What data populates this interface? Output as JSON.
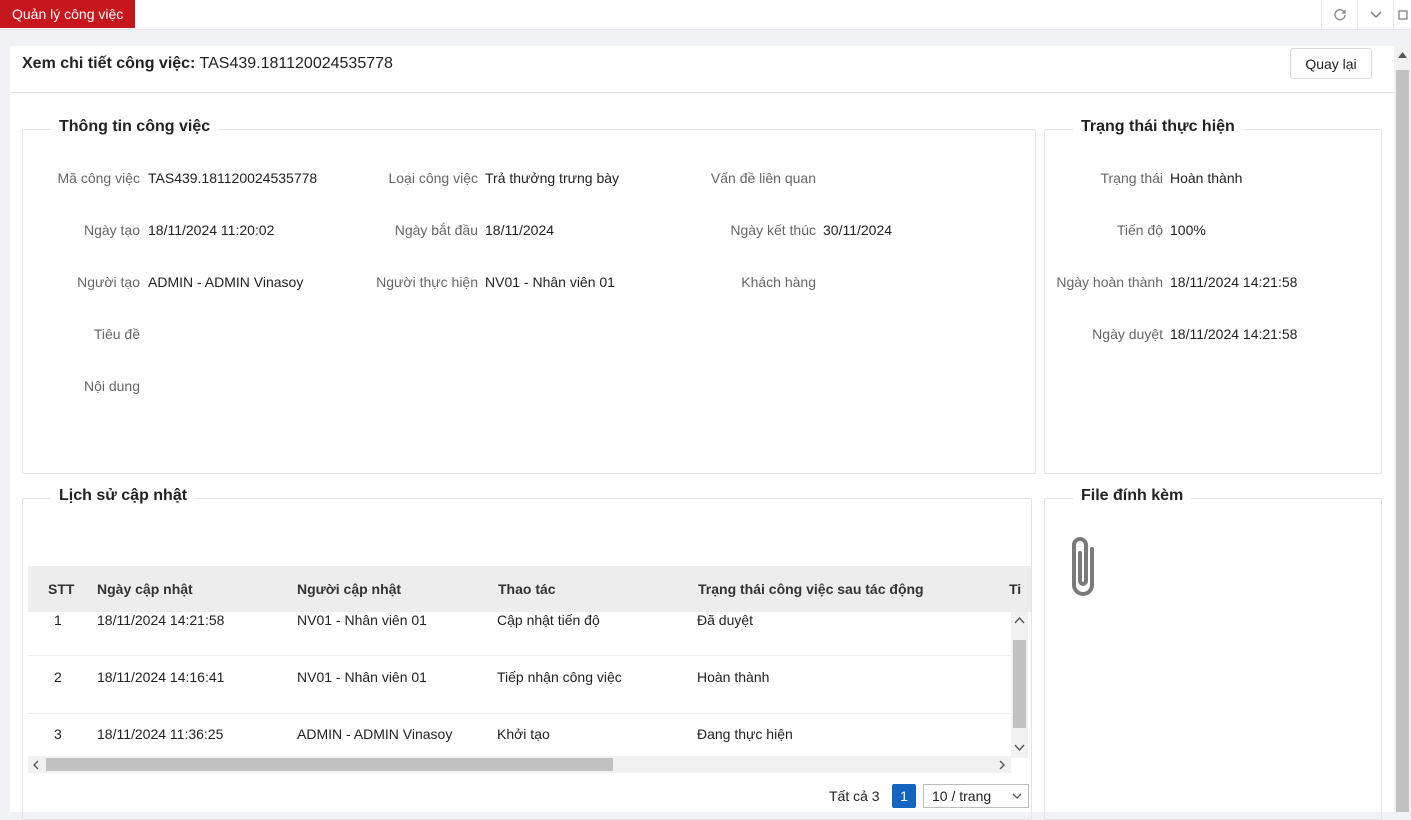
{
  "topbar": {
    "active_tab": "Quản lý công việc"
  },
  "header": {
    "title_label": "Xem chi tiết công việc:",
    "title_code": "TAS439.181120024535778",
    "back_button": "Quay lại"
  },
  "task_info": {
    "legend": "Thông tin công việc",
    "fields": [
      {
        "label": "Mã công việc",
        "value": "TAS439.181120024535778"
      },
      {
        "label": "Loại công việc",
        "value": "Trả thưởng trưng bày"
      },
      {
        "label": "Vấn đề liên quan",
        "value": ""
      },
      {
        "label": "Ngày tạo",
        "value": "18/11/2024 11:20:02"
      },
      {
        "label": "Ngày bắt đầu",
        "value": "18/11/2024"
      },
      {
        "label": "Ngày kết thúc",
        "value": "30/11/2024"
      },
      {
        "label": "Người tạo",
        "value": "ADMIN - ADMIN Vinasoy"
      },
      {
        "label": "Người thực hiện",
        "value": "NV01 - Nhân viên 01"
      },
      {
        "label": "Khách hàng",
        "value": ""
      },
      {
        "label": "Tiêu đề",
        "value": ""
      },
      {
        "label": "Nội dung",
        "value": ""
      }
    ]
  },
  "status": {
    "legend": "Trạng thái thực hiện",
    "fields": [
      {
        "label": "Trạng thái",
        "value": "Hoàn thành"
      },
      {
        "label": "Tiến độ",
        "value": "100%"
      },
      {
        "label": "Ngày hoàn thành",
        "value": "18/11/2024 14:21:58"
      },
      {
        "label": "Ngày duyệt",
        "value": "18/11/2024 14:21:58"
      }
    ]
  },
  "history": {
    "legend": "Lịch sử cập nhật",
    "columns": [
      "STT",
      "Ngày cập nhật",
      "Người cập nhật",
      "Thao tác",
      "Trạng thái công việc sau tác động",
      "Ti"
    ],
    "rows": [
      [
        "1",
        "18/11/2024 14:21:58",
        "NV01 - Nhân viên 01",
        "Cập nhật tiến độ",
        "Đã duyệt"
      ],
      [
        "2",
        "18/11/2024 14:16:41",
        "NV01 - Nhân viên 01",
        "Tiếp nhận công việc",
        "Hoàn thành"
      ],
      [
        "3",
        "18/11/2024 11:36:25",
        "ADMIN - ADMIN Vinasoy",
        "Khởi tạo",
        "Đang thực hiện"
      ]
    ],
    "pager": {
      "total": "Tất cả 3",
      "page": "1",
      "page_size": "10 / trang"
    }
  },
  "attachments": {
    "legend": "File đính kèm",
    "icon": "paperclip-icon"
  },
  "colors": {
    "accent_red": "#c8161d",
    "pager_blue": "#1565c0"
  }
}
